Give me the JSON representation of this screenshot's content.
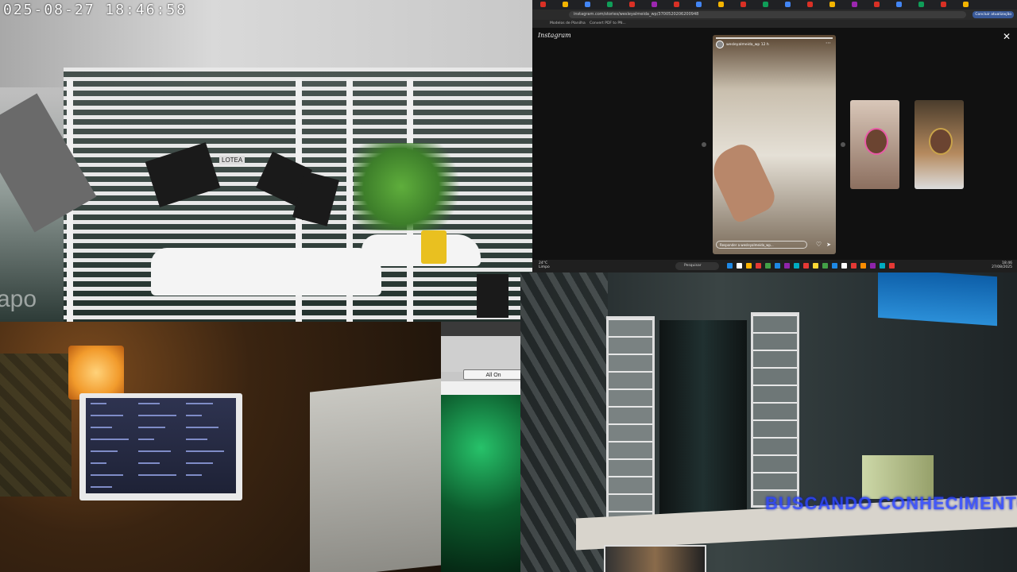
{
  "camera_top_left": {
    "timestamp": "025-08-27  18:46:58",
    "watermark": "apo",
    "gate_sign": "LOTEA"
  },
  "browser": {
    "url": "instagram.com/stories/wesleyalmeida_wp/3700520206200948",
    "update_button": "Concluir atualização",
    "bookmarks": [
      {
        "label": "Modelos de Planilha"
      },
      {
        "label": "Convert PDF to PN..."
      }
    ],
    "tab_colors": [
      "#d93025",
      "#f4b400",
      "#4285f4",
      "#0f9d58",
      "#d93025",
      "#9c27b0",
      "#d93025",
      "#4285f4",
      "#f4b400",
      "#d93025",
      "#0f9d58",
      "#4285f4",
      "#d93025",
      "#f4b400",
      "#9c27b0",
      "#d93025",
      "#4285f4",
      "#0f9d58",
      "#d93025",
      "#f4b400"
    ]
  },
  "instagram": {
    "logo": "Instagram",
    "story": {
      "username": "wesleyalmeida_wp  12 h",
      "reply_placeholder": "Responder a wesleyalmeida_wp..."
    }
  },
  "taskbar": {
    "weather_temp": "24°C",
    "weather_desc": "Limpo",
    "search_label": "Pesquisar",
    "time": "18:46",
    "date": "27/08/2025",
    "icon_colors": [
      "#1e88e5",
      "#ffffff",
      "#ffb300",
      "#e53935",
      "#43a047",
      "#1e88e5",
      "#8e24aa",
      "#00acc1",
      "#e53935",
      "#fdd835",
      "#43a047",
      "#1e88e5",
      "#ffffff",
      "#e53935",
      "#fb8c00",
      "#8e24aa",
      "#00acc1",
      "#e53935"
    ]
  },
  "mid_pane": {
    "all_on_label": "All On"
  },
  "studio_camera": {
    "marquee_text": "BUSCANDO CONHECIMENTO"
  }
}
